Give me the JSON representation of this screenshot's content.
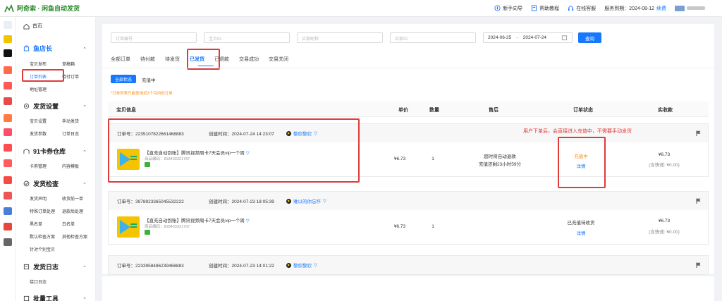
{
  "app": {
    "title": "阿奇索 · 闲鱼自动发货"
  },
  "topbar": {
    "guide": "新手向导",
    "help": "帮助教程",
    "service": "在线客服",
    "expiry": "服务到期：2024-08-12",
    "renew": "续费"
  },
  "sidebar": {
    "home": "首页",
    "sections": [
      {
        "title": "鱼店长",
        "items": [
          "宝贝发布",
          "草稿箱",
          "订单列表",
          "待付订单",
          "地址管理"
        ]
      },
      {
        "title": "发货设置",
        "items": [
          "宝贝设置",
          "手动发货",
          "发货参数",
          "订单日志"
        ]
      },
      {
        "title": "91卡券仓库",
        "items": [
          "卡券管理",
          "内容模板"
        ]
      },
      {
        "title": "发货检查",
        "items": [
          "发货声明",
          "收货前一单",
          "特殊订单处理",
          "退款后处理",
          "黑名单",
          "白名单",
          "默认检查方案",
          "其他检查方案",
          "针对个别宝贝"
        ]
      },
      {
        "title": "发货日志",
        "items": [
          "接口日志"
        ]
      },
      {
        "title": "批量工具",
        "items": []
      }
    ]
  },
  "filters": {
    "order_no": "订单编号",
    "item_id": "宝贝ID",
    "buyer": "买家昵称",
    "buyer_id": "买家ID",
    "date_from": "2024-06-25",
    "date_sep": "→",
    "date_to": "2024-07-24",
    "query": "查询"
  },
  "tabs": [
    "全部订单",
    "待付款",
    "待发货",
    "已发货",
    "已退款",
    "交易成功",
    "交易关闭"
  ],
  "subfilter": {
    "all": "全部状态",
    "recharging": "充值中"
  },
  "note": "*订单列表只能查询近3个月内的订单",
  "columns": {
    "item": "宝贝信息",
    "price": "单价",
    "qty": "数量",
    "after": "售后",
    "status": "订单状态",
    "paid": "实收款"
  },
  "annotation": "用户下单后，会直接进入充值中，不需要手动发货",
  "orders": [
    {
      "order_no": "订单号：2235107822661468883",
      "created": "创建时间：2024-07-24 14:23:07",
      "buyer": "黎欣黎欣",
      "title": "【直充自动到账】腾讯视频周卡7天会员vip一个周",
      "code": "商品编码：818403321787",
      "price": "¥6.73",
      "qty": "1",
      "after1": "超时将自动退款",
      "after2": "充值还剩23小时59分",
      "status": "充值中",
      "detail": "详情",
      "paid": "¥6.73",
      "paid_note": "(含快递: ¥0.00)"
    },
    {
      "order_no": "订单号：3978923365045532222",
      "created": "创建时间：2024-07-23 18:05:39",
      "buyer": "难以的你忘怀",
      "title": "【直充自动到账】腾讯视频周卡7天会员vip一个周",
      "code": "商品编码：818403321787",
      "price": "¥6.73",
      "qty": "1",
      "status": "已充值待收货",
      "detail": "详情",
      "paid": "¥6.73",
      "paid_note": "(含快递: ¥0.00)"
    },
    {
      "order_no": "订单号：2233958486239468883",
      "created": "创建时间：2024-07-23 14:01:22",
      "buyer": "黎欣黎欣"
    }
  ]
}
